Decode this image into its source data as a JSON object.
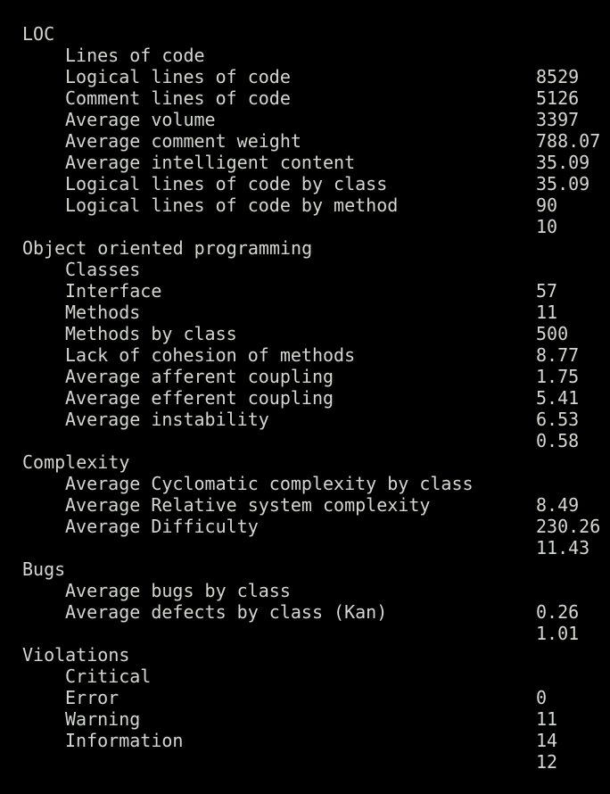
{
  "sections": [
    {
      "title": "LOC",
      "metrics": [
        {
          "label": "Lines of code",
          "value": "8529"
        },
        {
          "label": "Logical lines of code",
          "value": "5126"
        },
        {
          "label": "Comment lines of code",
          "value": "3397"
        },
        {
          "label": "Average volume",
          "value": "788.07"
        },
        {
          "label": "Average comment weight",
          "value": "35.09"
        },
        {
          "label": "Average intelligent content",
          "value": "35.09"
        },
        {
          "label": "Logical lines of code by class",
          "value": "90"
        },
        {
          "label": "Logical lines of code by method",
          "value": "10"
        }
      ]
    },
    {
      "title": "Object oriented programming",
      "metrics": [
        {
          "label": "Classes",
          "value": "57"
        },
        {
          "label": "Interface",
          "value": "11"
        },
        {
          "label": "Methods",
          "value": "500"
        },
        {
          "label": "Methods by class",
          "value": "8.77"
        },
        {
          "label": "Lack of cohesion of methods",
          "value": "1.75"
        },
        {
          "label": "Average afferent coupling",
          "value": "5.41"
        },
        {
          "label": "Average efferent coupling",
          "value": "6.53"
        },
        {
          "label": "Average instability",
          "value": "0.58"
        }
      ]
    },
    {
      "title": "Complexity",
      "metrics": [
        {
          "label": "Average Cyclomatic complexity by class",
          "value": "8.49"
        },
        {
          "label": "Average Relative system complexity",
          "value": "230.26"
        },
        {
          "label": "Average Difficulty",
          "value": "11.43"
        }
      ]
    },
    {
      "title": "Bugs",
      "metrics": [
        {
          "label": "Average bugs by class",
          "value": "0.26"
        },
        {
          "label": "Average defects by class (Kan)",
          "value": "1.01"
        }
      ]
    },
    {
      "title": "Violations",
      "metrics": [
        {
          "label": "Critical",
          "value": "0"
        },
        {
          "label": "Error",
          "value": "11"
        },
        {
          "label": "Warning",
          "value": "14"
        },
        {
          "label": "Information",
          "value": "12"
        }
      ]
    }
  ]
}
